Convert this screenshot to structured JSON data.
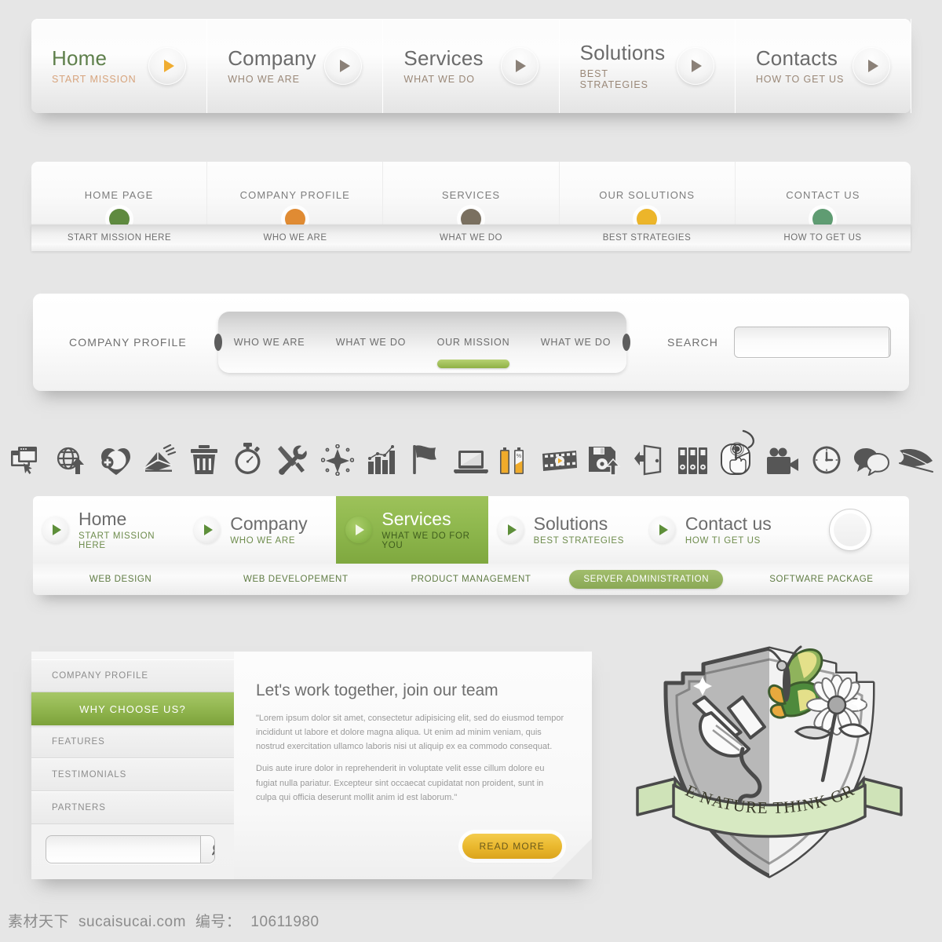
{
  "nav_primary": {
    "items": [
      {
        "title": "Home",
        "sub": "START MISSION",
        "active": true
      },
      {
        "title": "Company",
        "sub": "WHO WE ARE",
        "active": false
      },
      {
        "title": "Services",
        "sub": "WHAT WE DO",
        "active": false
      },
      {
        "title": "Solutions",
        "sub": "BEST STRATEGIES",
        "active": false
      },
      {
        "title": "Contacts",
        "sub": "HOW TO GET US",
        "active": false
      }
    ]
  },
  "nav_secondary": {
    "items": [
      {
        "title": "HOME PAGE",
        "sub": "START MISSION HERE",
        "dot": "#5f8a3f"
      },
      {
        "title": "COMPANY PROFILE",
        "sub": "WHO WE ARE",
        "dot": "#e08b33"
      },
      {
        "title": "SERVICES",
        "sub": "WHAT WE DO",
        "dot": "#7a7060"
      },
      {
        "title": "OUR SOLUTIONS",
        "sub": "BEST STRATEGIES",
        "dot": "#ecb52a"
      },
      {
        "title": "CONTACT US",
        "sub": "HOW TO GET US",
        "dot": "#5f9c72"
      }
    ]
  },
  "nav_capsule": {
    "label": "COMPANY PROFILE",
    "items": [
      {
        "label": "WHO WE ARE",
        "active": false
      },
      {
        "label": "WHAT WE DO",
        "active": false
      },
      {
        "label": "OUR MISSION",
        "active": true
      },
      {
        "label": "WHAT WE DO",
        "active": false
      }
    ],
    "search_label": "SEARCH",
    "search_value": "",
    "search_placeholder": "",
    "search_icon": "magnifier-icon"
  },
  "icon_row": {
    "icons": [
      "browser-window-cursor-icon",
      "globe-upload-icon",
      "heart-plus-icon",
      "envelope-send-icon",
      "trash-icon",
      "stopwatch-icon",
      "tools-wrench-screwdriver-icon",
      "compass-network-icon",
      "bar-chart-icon",
      "flag-icon",
      "laptop-icon",
      "battery-level-icon",
      "film-strip-icon",
      "floppy-disk-upload-icon",
      "exit-door-icon",
      "binders-archive-icon",
      "mouse-click-icon",
      "video-camera-icon",
      "clock-icon",
      "speech-bubbles-icon",
      "feather-quill-icon"
    ]
  },
  "nav_services": {
    "items": [
      {
        "title": "Home",
        "sub": "START MISSION HERE",
        "active": false
      },
      {
        "title": "Company",
        "sub": "WHO WE ARE",
        "active": false
      },
      {
        "title": "Services",
        "sub": "WHAT WE DO FOR YOU",
        "active": true
      },
      {
        "title": "Solutions",
        "sub": "BEST STRATEGIES",
        "active": false
      },
      {
        "title": "Contact us",
        "sub": "HOW TI GET US",
        "active": false
      }
    ],
    "sub_items": [
      {
        "label": "WEB DESIGN",
        "active": false
      },
      {
        "label": "WEB DEVELOPEMENT",
        "active": false
      },
      {
        "label": "PRODUCT MANAGEMENT",
        "active": false
      },
      {
        "label": "SERVER ADMINISTRATION",
        "active": true
      },
      {
        "label": "SOFTWARE PACKAGE",
        "active": false
      }
    ]
  },
  "content_panel": {
    "sidebar": [
      {
        "label": "COMPANY PROFILE",
        "active": false
      },
      {
        "label": "WHY CHOOSE US?",
        "active": true
      },
      {
        "label": "FEATURES",
        "active": false
      },
      {
        "label": "TESTIMONIALS",
        "active": false
      },
      {
        "label": "PARTNERS",
        "active": false
      }
    ],
    "sidebar_search_value": "",
    "sidebar_search_placeholder": "",
    "heading": "Let's work together, join our team",
    "paragraph1": "\"Lorem ipsum dolor sit amet, consectetur adipisicing elit, sed do eiusmod tempor incididunt ut labore et dolore magna aliqua. Ut enim ad minim veniam, quis nostrud exercitation ullamco laboris nisi ut aliquip ex ea commodo consequat.",
    "paragraph2": "Duis aute irure dolor in reprehenderit in voluptate velit esse cillum dolore eu fugiat nulla pariatur. Excepteur sint occaecat cupidatat non proident, sunt in culpa qui officia deserunt mollit anim id est laborum.\"",
    "read_more": "READ MORE"
  },
  "logo": {
    "banner_text": "LOVE NATURE THINK GREEN",
    "elements": [
      "shield",
      "electrical-plug",
      "butterfly",
      "daisy-flower",
      "ribbon-banner"
    ]
  },
  "footer": {
    "site_cn": "素材天下",
    "site": "sucaisucai.com",
    "id_label": "编号：",
    "id_value": "10611980"
  },
  "colors": {
    "accent_green": "#8fb84e",
    "accent_green_dark": "#7da23b",
    "accent_amber": "#eab92f",
    "accent_tan": "#d7a47d",
    "text_gray": "#6f6f6f",
    "bg": "#e6e6e6"
  }
}
